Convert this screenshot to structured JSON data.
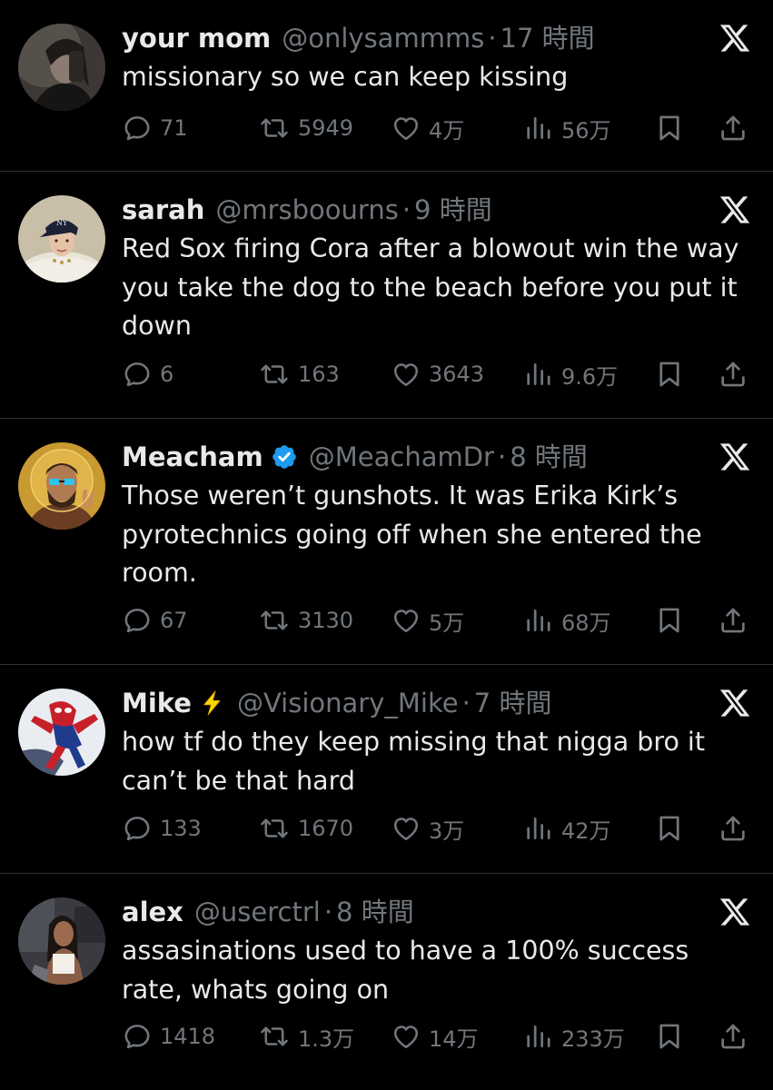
{
  "colors": {
    "background": "#000000",
    "text": "#e7e9ea",
    "muted": "#71767b",
    "divider": "#2f3336",
    "verified": "#1d9bf0",
    "lightning": "#ffd400"
  },
  "icons": {
    "reply": "reply-icon",
    "retweet": "retweet-icon",
    "like": "heart-icon",
    "views": "views-icon",
    "bookmark": "bookmark-icon",
    "share": "share-icon",
    "platform": "x-logo-icon",
    "verified": "verified-badge-icon",
    "lightning": "lightning-emoji-icon"
  },
  "tweets": [
    {
      "name": "your mom",
      "handle": "@onlysammms",
      "dot": "·",
      "time": "17 時間",
      "text": "missionary so we can keep kissing",
      "replies": "71",
      "retweets": "5949",
      "likes": "4万",
      "views": "56万"
    },
    {
      "name": "sarah",
      "handle": "@mrsboourns",
      "dot": "·",
      "time": "9 時間",
      "text": "Red Sox firing Cora after a blowout win the way you take the dog to the beach before you put it down",
      "replies": "6",
      "retweets": "163",
      "likes": "3643",
      "views": "9.6万"
    },
    {
      "name": "Meacham",
      "handle": "@MeachamDr",
      "dot": "·",
      "time": "8 時間",
      "text": "Those weren’t gunshots. It was Erika Kirk’s pyrotechnics going off when she entered the room.",
      "replies": "67",
      "retweets": "3130",
      "likes": "5万",
      "views": "68万"
    },
    {
      "name": "Mike",
      "handle": "@Visionary_Mike",
      "dot": "·",
      "time": "7 時間",
      "text": "how tf do they keep missing that nigga bro it can’t be that hard",
      "replies": "133",
      "retweets": "1670",
      "likes": "3万",
      "views": "42万"
    },
    {
      "name": "alex",
      "handle": "@userctrl",
      "dot": "·",
      "time": "8 時間",
      "text": "assasinations used to have a 100% success rate, whats going on",
      "replies": "1418",
      "retweets": "1.3万",
      "likes": "14万",
      "views": "233万"
    }
  ]
}
